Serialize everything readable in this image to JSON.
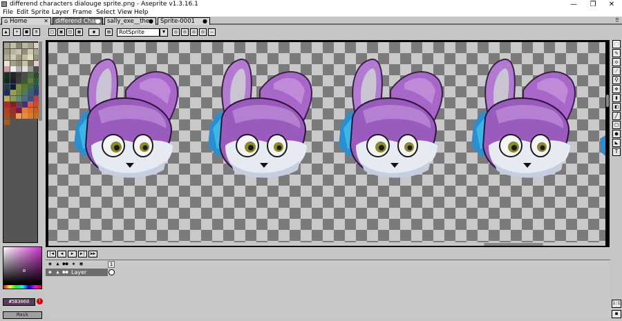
{
  "window": {
    "title": "differend characters dialouge sprite.png - Aseprite v1.3.16.1",
    "controls": [
      "—",
      "❐",
      "✕"
    ]
  },
  "menu": [
    "File",
    "Edit",
    "Sprite",
    "Layer",
    "Frame",
    "Select",
    "View",
    "Help"
  ],
  "tabs": [
    {
      "label": "Home",
      "active": false
    },
    {
      "label": "differend Chara",
      "active": true
    },
    {
      "label": "sally_exe__the",
      "active": false
    },
    {
      "label": "Sprite-0001",
      "active": false
    }
  ],
  "context_bar": {
    "rotation_algorithm": "RotSprite"
  },
  "color": {
    "hex_label": "#5B3060",
    "mask_label": "Mask",
    "warning": "!"
  },
  "palette_colors": [
    "#a8a48c",
    "#c4c0a8",
    "#8c8870",
    "#bcb89c",
    "#a4a088",
    "#d8d4bc",
    "#9c987c",
    "#b8b49c",
    "#c8c4a8",
    "#948c74",
    "#ccc8b0",
    "#aca890",
    "#b0ac94",
    "#d0ccb4",
    "#a09c84",
    "#c0bca4",
    "#e0dcc4",
    "#989478",
    "#e8e4d4",
    "#a4a08c",
    "#8c8874",
    "#c4c0ac",
    "#7c7864",
    "#eac8cc",
    "#c89ca8",
    "#f0f0f0",
    "#b0b0b0",
    "#e0e0e0",
    "#989898",
    "#445444",
    "#1c301c",
    "#242424",
    "#383838",
    "#4c4c4c",
    "#4c6c3c",
    "#2c4c2c",
    "#0c2c1c",
    "#1c1c2c",
    "#3c3c3c",
    "#3c5c2c",
    "#5c7c3c",
    "#2c5c3c",
    "#1c3c4c",
    "#0c1c3c",
    "#7c8c3c",
    "#5c7c2c",
    "#3c6c4c",
    "#2c4c5c",
    "#1c2c5c",
    "#9c9c4c",
    "#6c8c3c",
    "#4c7c5c",
    "#3c5c7c",
    "#2c3c7c",
    "#bcac5c",
    "#8c9c4c",
    "#5c8c6c",
    "#4c6c8c",
    "#3c4c8c",
    "#cc3c3c",
    "#ac2c2c",
    "#8c1c1c",
    "#6c3c5c",
    "#4c2c6c",
    "#dc5c3c",
    "#cc4c2c",
    "#bc3c1c",
    "#9c2c2c",
    "#7c1c3c",
    "#e87c3c",
    "#dc6c2c",
    "#cc5c1c",
    "#ac4c1c",
    "#8c3c1c",
    "#f09c4c",
    "#e88c3c",
    "#d87c2c",
    "#c86c1c",
    "#a85c1c"
  ],
  "timeline": {
    "layer_name": "Layer",
    "frame_number": "1"
  },
  "tools": [
    "marquee-icon",
    "pencil-icon",
    "eraser-icon",
    "eyedropper-icon",
    "zoom-icon",
    "move-icon",
    "fill-icon",
    "gradient-icon",
    "line-icon",
    "rectangle-icon",
    "blur-icon",
    "ellipse-icon",
    "text-icon"
  ]
}
